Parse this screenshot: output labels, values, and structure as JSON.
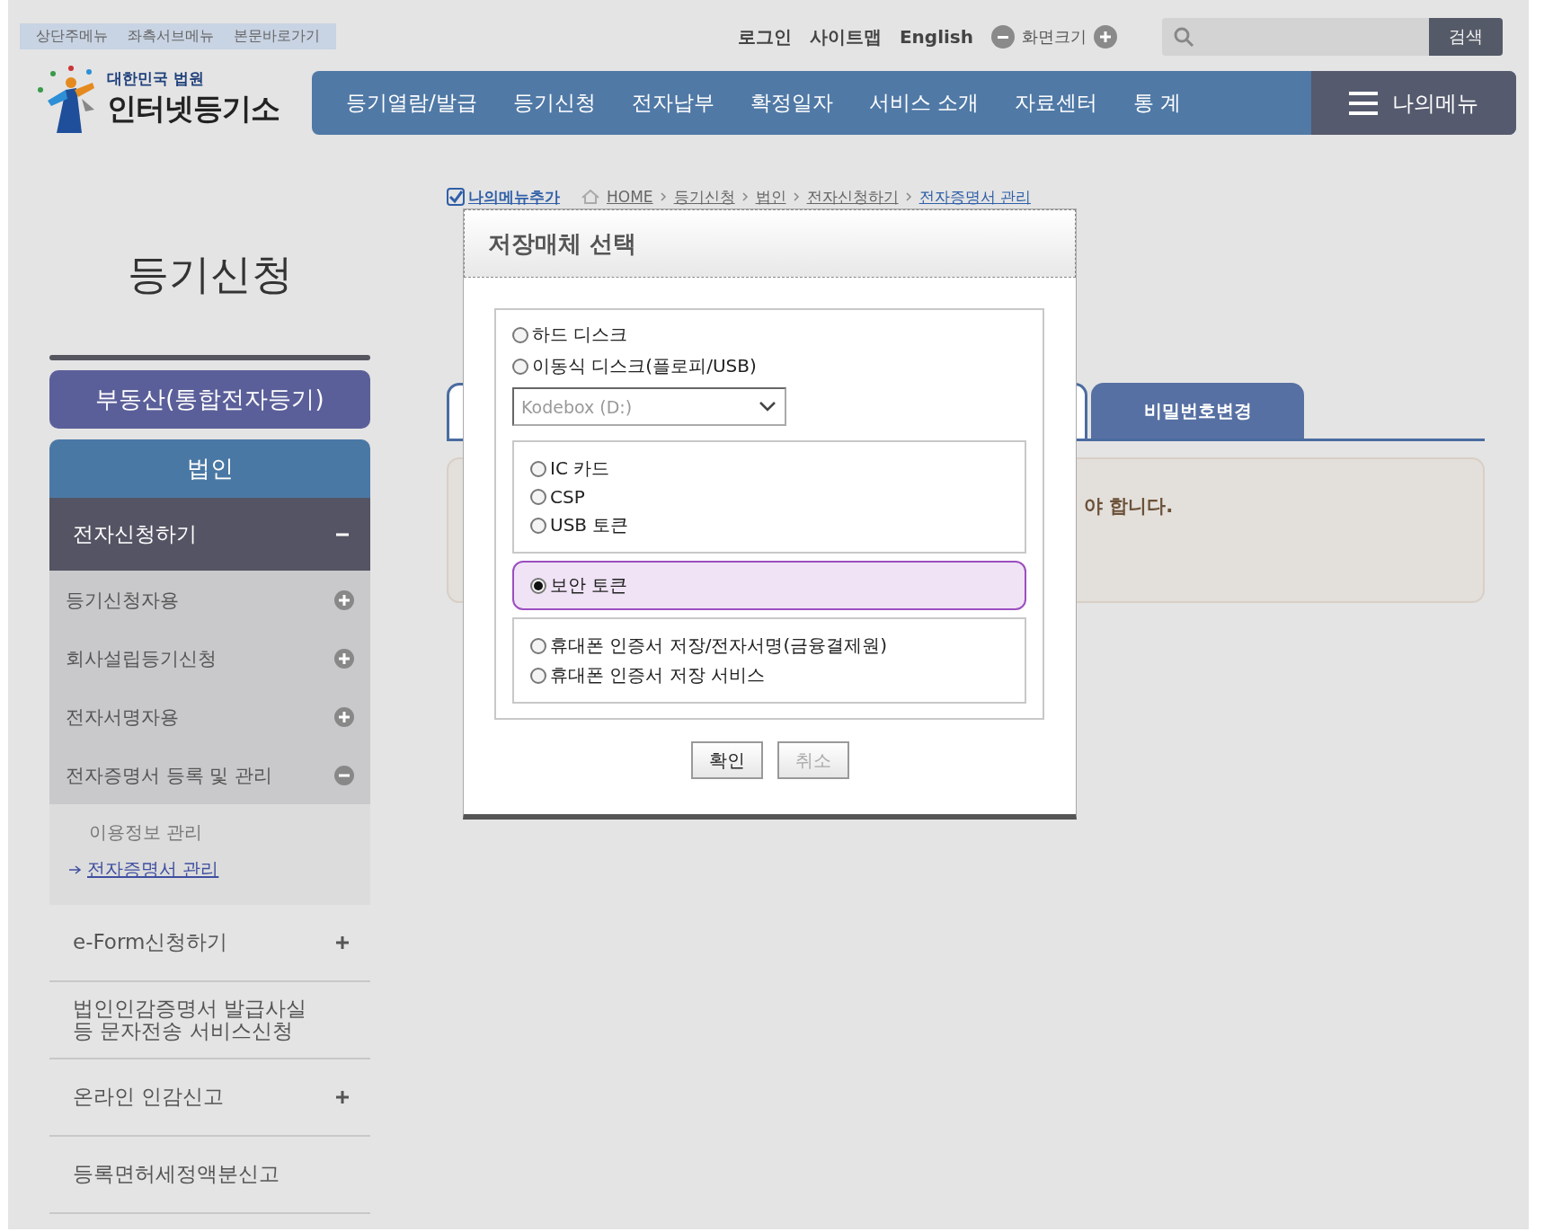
{
  "header": {
    "skip_links": [
      "상단주메뉴",
      "좌측서브메뉴",
      "본문바로가기"
    ],
    "util_links": [
      "로그인",
      "사이트맵",
      "English"
    ],
    "zoom_label": "화면크기",
    "search": {
      "button": "검색"
    },
    "logo": {
      "top": "대한민국 법원",
      "main": "인터넷등기소"
    },
    "nav": [
      "등기열람/발급",
      "등기신청",
      "전자납부",
      "확정일자",
      "서비스 소개",
      "자료센터",
      "통 계"
    ],
    "my_menu": "나의메뉴"
  },
  "sidebar": {
    "title": "등기신청",
    "categories": [
      {
        "label": "부동산(통합전자등기)",
        "selected": false
      },
      {
        "label": "법인",
        "selected": true
      }
    ],
    "groups": [
      {
        "label": "전자신청하기",
        "expandable": true,
        "expanded": true,
        "children": [
          {
            "label": "등기신청자용",
            "expanded": false
          },
          {
            "label": "회사설립등기신청",
            "expanded": false
          },
          {
            "label": "전자서명자용",
            "expanded": false
          },
          {
            "label": "전자증명서 등록 및 관리",
            "expanded": true,
            "children": [
              {
                "label": "이용정보 관리",
                "selected": false
              },
              {
                "label": "전자증명서 관리",
                "selected": true
              }
            ]
          }
        ]
      },
      {
        "label": "e-Form신청하기",
        "expandable": true,
        "expanded": false
      },
      {
        "label": "법인인감증명서 발급사실\n등 문자전송 서비스신청",
        "expandable": false,
        "expanded": false
      },
      {
        "label": "온라인 인감신고",
        "expandable": true,
        "expanded": false
      },
      {
        "label": "등록면허세정액분신고",
        "expandable": false,
        "expanded": false
      }
    ]
  },
  "breadcrumb": {
    "add_label": "나의메뉴추가",
    "items": [
      "HOME",
      "등기신청",
      "법인",
      "전자신청하기",
      "전자증명서 관리"
    ]
  },
  "tabs": [
    {
      "selected": true
    },
    {
      "label": "비밀번호변경",
      "selected": false
    }
  ],
  "notice": {
    "text": "야 합니다."
  },
  "dialog": {
    "title": "저장매체 선택",
    "groups": [
      {
        "kind": "plain",
        "options": [
          {
            "label": "하드 디스크",
            "selected": false
          },
          {
            "label": "이동식 디스크(플로피/USB)",
            "selected": false
          }
        ],
        "select": {
          "value": "Kodebox (D:)",
          "disabled": true
        }
      },
      {
        "kind": "boxed",
        "options": [
          {
            "label": "IC 카드",
            "selected": false
          },
          {
            "label": "CSP",
            "selected": false
          },
          {
            "label": "USB 토큰",
            "selected": false
          }
        ]
      },
      {
        "kind": "highlighted",
        "options": [
          {
            "label": "보안 토큰",
            "selected": true
          }
        ]
      },
      {
        "kind": "boxed",
        "options": [
          {
            "label": "휴대폰 인증서 저장/전자서명(금융결제원)",
            "selected": false
          },
          {
            "label": "휴대폰 인증서 저장 서비스",
            "selected": false
          }
        ]
      }
    ],
    "buttons": [
      {
        "label": "확인",
        "disabled": false
      },
      {
        "label": "취소",
        "disabled": true
      }
    ]
  }
}
